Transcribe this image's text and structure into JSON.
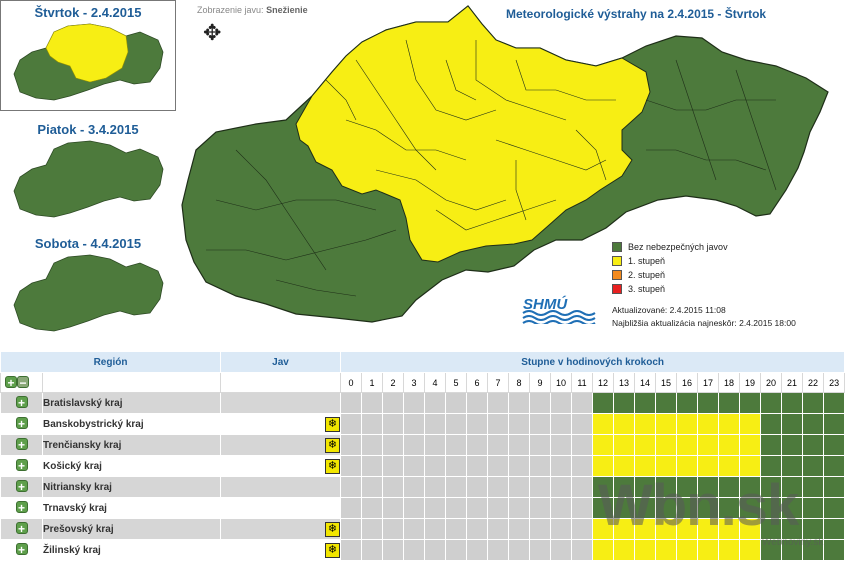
{
  "mini_maps": [
    {
      "day": "Štvrtok - 2.4.2015",
      "state": "warning"
    },
    {
      "day": "Piatok - 3.4.2015",
      "state": "calm"
    },
    {
      "day": "Sobota - 4.4.2015",
      "state": "calm"
    }
  ],
  "view_label": {
    "prefix": "Zobrazenie javu:",
    "value": "Snežienie"
  },
  "move_icon": "move-arrows-icon",
  "title": "Meteorologické výstrahy na 2.4.2015 - Štvrtok",
  "legend": [
    {
      "label": "Bez nebezpečných javov",
      "color": "#4d7a3c"
    },
    {
      "label": "1. stupeň",
      "color": "#f7ee14"
    },
    {
      "label": "2. stupeň",
      "color": "#f28a1e"
    },
    {
      "label": "3. stupeň",
      "color": "#e82020"
    }
  ],
  "logo_text": "SHMÚ",
  "updated": "Aktualizované: 2.4.2015 11:08",
  "next_update": "Najbližšia aktualizácia najneskôr: 2.4.2015 18:00",
  "colors": {
    "calm": "#4d7a3c",
    "level1": "#f7ee14",
    "past": "#cfcfcf"
  },
  "table": {
    "col_region": "Región",
    "col_jav": "Jav",
    "col_steps": "Stupne v hodinových krokoch",
    "hours": [
      "0",
      "1",
      "2",
      "3",
      "4",
      "5",
      "6",
      "7",
      "8",
      "9",
      "10",
      "11",
      "12",
      "13",
      "14",
      "15",
      "16",
      "17",
      "18",
      "19",
      "20",
      "21",
      "22",
      "23"
    ],
    "rows": [
      {
        "name": "Bratislavský kraj",
        "snow": false,
        "cells": [
          "g",
          "g",
          "g",
          "g",
          "g",
          "g",
          "g",
          "g",
          "g",
          "g",
          "g",
          "g",
          "gr",
          "gr",
          "gr",
          "gr",
          "gr",
          "gr",
          "gr",
          "gr",
          "gr",
          "gr",
          "gr",
          "gr"
        ]
      },
      {
        "name": "Banskobystrický kraj",
        "snow": true,
        "cells": [
          "g",
          "g",
          "g",
          "g",
          "g",
          "g",
          "g",
          "g",
          "g",
          "g",
          "g",
          "g",
          "ye",
          "ye",
          "ye",
          "ye",
          "ye",
          "ye",
          "ye",
          "ye",
          "gr",
          "gr",
          "gr",
          "gr"
        ]
      },
      {
        "name": "Trenčiansky kraj",
        "snow": true,
        "cells": [
          "g",
          "g",
          "g",
          "g",
          "g",
          "g",
          "g",
          "g",
          "g",
          "g",
          "g",
          "g",
          "ye",
          "ye",
          "ye",
          "ye",
          "ye",
          "ye",
          "ye",
          "ye",
          "gr",
          "gr",
          "gr",
          "gr"
        ]
      },
      {
        "name": "Košický kraj",
        "snow": true,
        "cells": [
          "g",
          "g",
          "g",
          "g",
          "g",
          "g",
          "g",
          "g",
          "g",
          "g",
          "g",
          "g",
          "ye",
          "ye",
          "ye",
          "ye",
          "ye",
          "ye",
          "ye",
          "ye",
          "gr",
          "gr",
          "gr",
          "gr"
        ]
      },
      {
        "name": "Nitriansky kraj",
        "snow": false,
        "cells": [
          "g",
          "g",
          "g",
          "g",
          "g",
          "g",
          "g",
          "g",
          "g",
          "g",
          "g",
          "g",
          "gr",
          "gr",
          "gr",
          "gr",
          "gr",
          "gr",
          "gr",
          "gr",
          "gr",
          "gr",
          "gr",
          "gr"
        ]
      },
      {
        "name": "Trnavský kraj",
        "snow": false,
        "cells": [
          "g",
          "g",
          "g",
          "g",
          "g",
          "g",
          "g",
          "g",
          "g",
          "g",
          "g",
          "g",
          "gr",
          "gr",
          "gr",
          "gr",
          "gr",
          "gr",
          "gr",
          "gr",
          "gr",
          "gr",
          "gr",
          "gr"
        ]
      },
      {
        "name": "Prešovský kraj",
        "snow": true,
        "cells": [
          "g",
          "g",
          "g",
          "g",
          "g",
          "g",
          "g",
          "g",
          "g",
          "g",
          "g",
          "g",
          "ye",
          "ye",
          "ye",
          "ye",
          "ye",
          "ye",
          "ye",
          "ye",
          "gr",
          "gr",
          "gr",
          "gr"
        ]
      },
      {
        "name": "Žilinský kraj",
        "snow": true,
        "cells": [
          "g",
          "g",
          "g",
          "g",
          "g",
          "g",
          "g",
          "g",
          "g",
          "g",
          "g",
          "g",
          "ye",
          "ye",
          "ye",
          "ye",
          "ye",
          "ye",
          "ye",
          "ye",
          "gr",
          "gr",
          "gr",
          "gr"
        ]
      }
    ]
  },
  "watermark": "Wbn.sk",
  "watermark_small": "Webnoviny.sk"
}
